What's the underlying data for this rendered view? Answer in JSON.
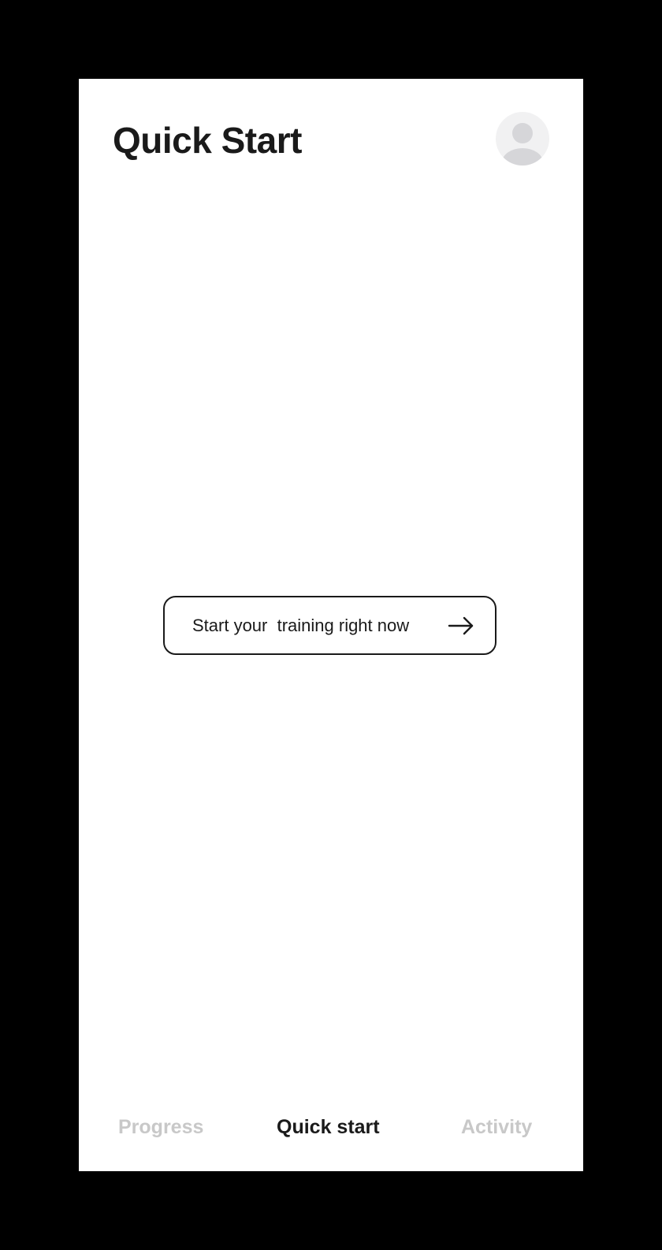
{
  "header": {
    "title": "Quick Start",
    "avatar_icon": "user-avatar-icon"
  },
  "main": {
    "cta_label": "Start your  training right now",
    "cta_icon": "arrow-right-icon"
  },
  "bottom_nav": {
    "items": [
      {
        "label": "Progress",
        "active": false
      },
      {
        "label": "Quick start",
        "active": true
      },
      {
        "label": "Activity",
        "active": false
      }
    ]
  },
  "colors": {
    "background": "#ffffff",
    "text": "#1a1a1a",
    "inactive": "#c8c8c8",
    "avatar_bg": "#f1f1f2",
    "avatar_fg": "#d6d6d9"
  }
}
